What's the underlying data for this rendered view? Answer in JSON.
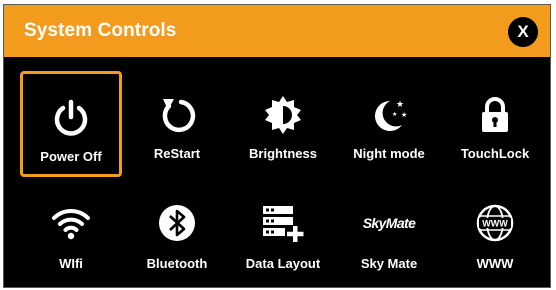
{
  "dialog": {
    "title": "System Controls",
    "close_label": "X"
  },
  "controls": [
    {
      "label": "Power Off",
      "icon": "power-icon",
      "selected": true
    },
    {
      "label": "ReStart",
      "icon": "restart-icon"
    },
    {
      "label": "Brightness",
      "icon": "brightness-icon"
    },
    {
      "label": "Night mode",
      "icon": "night-mode-icon"
    },
    {
      "label": "TouchLock",
      "icon": "lock-icon"
    },
    {
      "label": "WIfi",
      "icon": "wifi-icon"
    },
    {
      "label": "Bluetooth",
      "icon": "bluetooth-icon"
    },
    {
      "label": "Data Layout",
      "icon": "data-layout-icon"
    },
    {
      "label": "Sky Mate",
      "icon": "skymate-logo-icon",
      "icon_text": "SkyMate"
    },
    {
      "label": "WWW",
      "icon": "globe-icon",
      "icon_text": "WWW"
    }
  ],
  "colors": {
    "accent": "#f29b1c",
    "background": "#000000",
    "text": "#ffffff"
  }
}
